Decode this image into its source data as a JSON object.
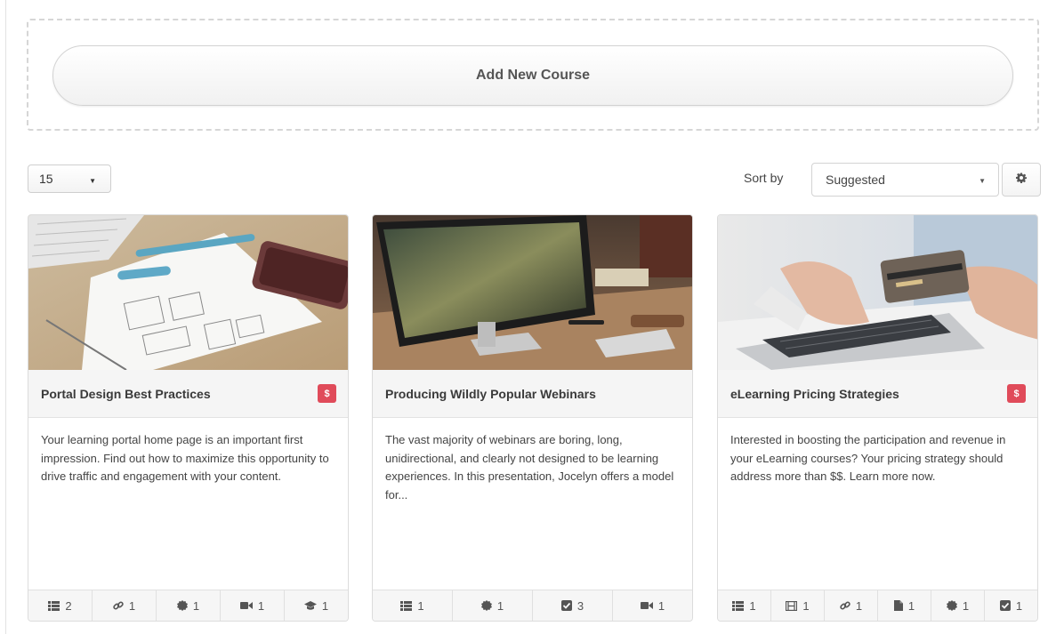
{
  "add_course": {
    "label": "Add New Course"
  },
  "toolbar": {
    "per_page": "15",
    "sort_label": "Sort by",
    "sort_value": "Suggested"
  },
  "colors": {
    "price_badge": "#e04b5a",
    "title_bar": "#f5f5f5"
  },
  "courses": [
    {
      "title": "Portal Design Best Practices",
      "price_badge": "$",
      "image": "wireframe-sketch-desk",
      "description": "Your learning portal home page is an important first impression. Find out how to maximize this opportunity to drive traffic and engagement with your content.",
      "stats": [
        {
          "icon": "list-icon",
          "count": "2"
        },
        {
          "icon": "link-icon",
          "count": "1"
        },
        {
          "icon": "badge-icon",
          "count": "1"
        },
        {
          "icon": "video-icon",
          "count": "1"
        },
        {
          "icon": "graduation-cap-icon",
          "count": "1"
        }
      ]
    },
    {
      "title": "Producing Wildly Popular Webinars",
      "price_badge": "",
      "image": "desktop-monitor-workspace",
      "description": "The vast majority of webinars are boring, long, unidirectional, and clearly not designed to be learning experiences. In this presentation, Jocelyn offers a model for...",
      "stats": [
        {
          "icon": "list-icon",
          "count": "1"
        },
        {
          "icon": "badge-icon",
          "count": "1"
        },
        {
          "icon": "checkbox-icon",
          "count": "3"
        },
        {
          "icon": "video-icon",
          "count": "1"
        }
      ]
    },
    {
      "title": "eLearning Pricing Strategies",
      "price_badge": "$",
      "image": "credit-card-laptop",
      "description": "Interested in boosting the participation and revenue in your eLearning courses? Your pricing strategy should address more than $$. Learn more now.",
      "stats": [
        {
          "icon": "list-icon",
          "count": "1"
        },
        {
          "icon": "film-icon",
          "count": "1"
        },
        {
          "icon": "link-icon",
          "count": "1"
        },
        {
          "icon": "file-icon",
          "count": "1"
        },
        {
          "icon": "badge-icon",
          "count": "1"
        },
        {
          "icon": "checkbox-icon",
          "count": "1"
        }
      ]
    }
  ]
}
